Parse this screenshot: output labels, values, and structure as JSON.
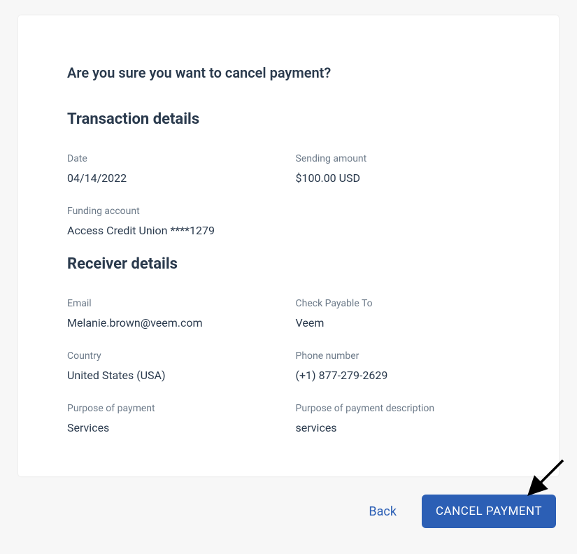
{
  "prompt": {
    "title": "Are you sure you want to cancel payment?"
  },
  "transaction": {
    "heading": "Transaction details",
    "date_label": "Date",
    "date_value": "04/14/2022",
    "sending_amount_label": "Sending amount",
    "sending_amount_value": "$100.00 USD",
    "funding_account_label": "Funding account",
    "funding_account_value": "Access Credit Union ****1279"
  },
  "receiver": {
    "heading": "Receiver details",
    "email_label": "Email",
    "email_value": "Melanie.brown@veem.com",
    "check_payable_label": "Check Payable To",
    "check_payable_value": "Veem",
    "country_label": "Country",
    "country_value": "United States (USA)",
    "phone_label": "Phone number",
    "phone_value": "(+1) 877-279-2629",
    "purpose_label": "Purpose of payment",
    "purpose_value": "Services",
    "purpose_desc_label": "Purpose of payment description",
    "purpose_desc_value": "services"
  },
  "actions": {
    "back": "Back",
    "cancel": "CANCEL PAYMENT"
  }
}
